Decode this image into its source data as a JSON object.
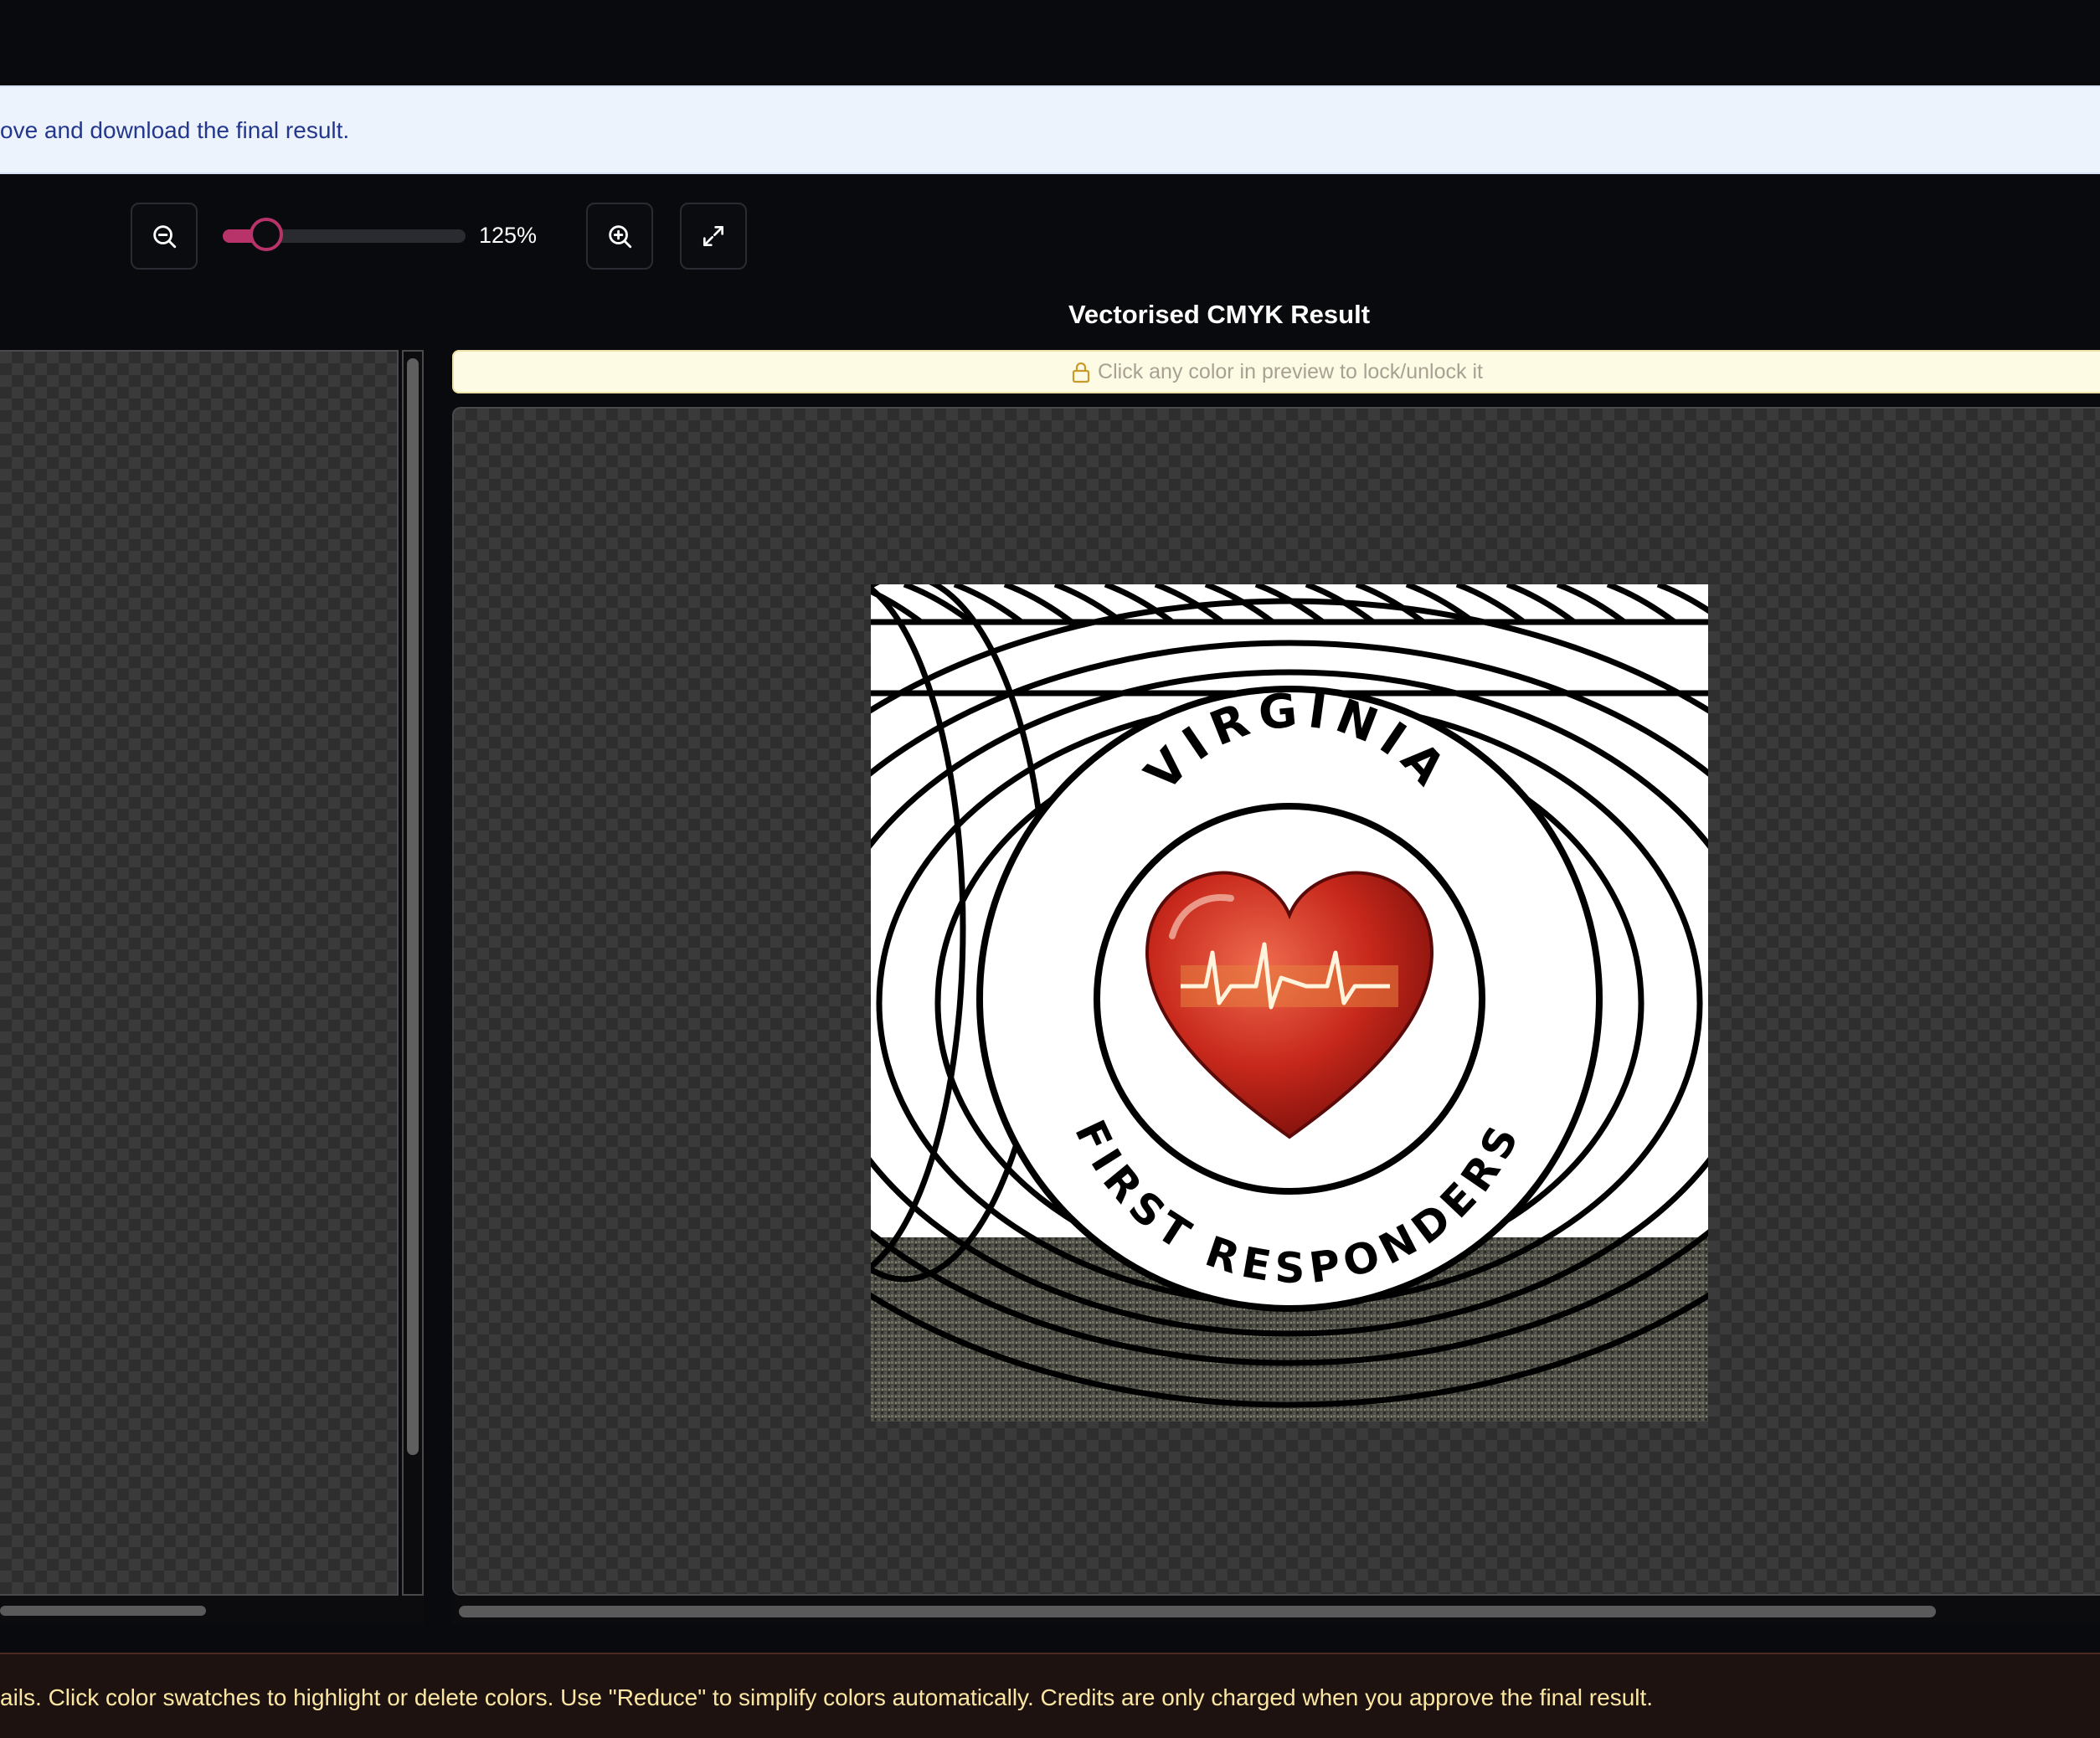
{
  "banner": {
    "text": "ove and download the final result."
  },
  "toolbar": {
    "zoom_out_icon": "zoom-out-icon",
    "zoom_in_icon": "zoom-in-icon",
    "fullscreen_icon": "expand-icon",
    "zoom_label": "125%",
    "zoom_fraction": 0.18,
    "accent_color": "#b8336a"
  },
  "result": {
    "title": "Vectorised CMYK Result",
    "lock_hint": "Click any color in preview to lock/unlock it",
    "lock_icon": "lock-icon"
  },
  "artwork": {
    "top_text": "VIRGINIA",
    "bottom_text": "FIRST RESPONDERS",
    "heart_color": "#c7281b"
  },
  "footer": {
    "text": "ails. Click color swatches to highlight or delete colors. Use \"Reduce\" to simplify colors automatically. Credits are only charged when you approve the final result."
  }
}
